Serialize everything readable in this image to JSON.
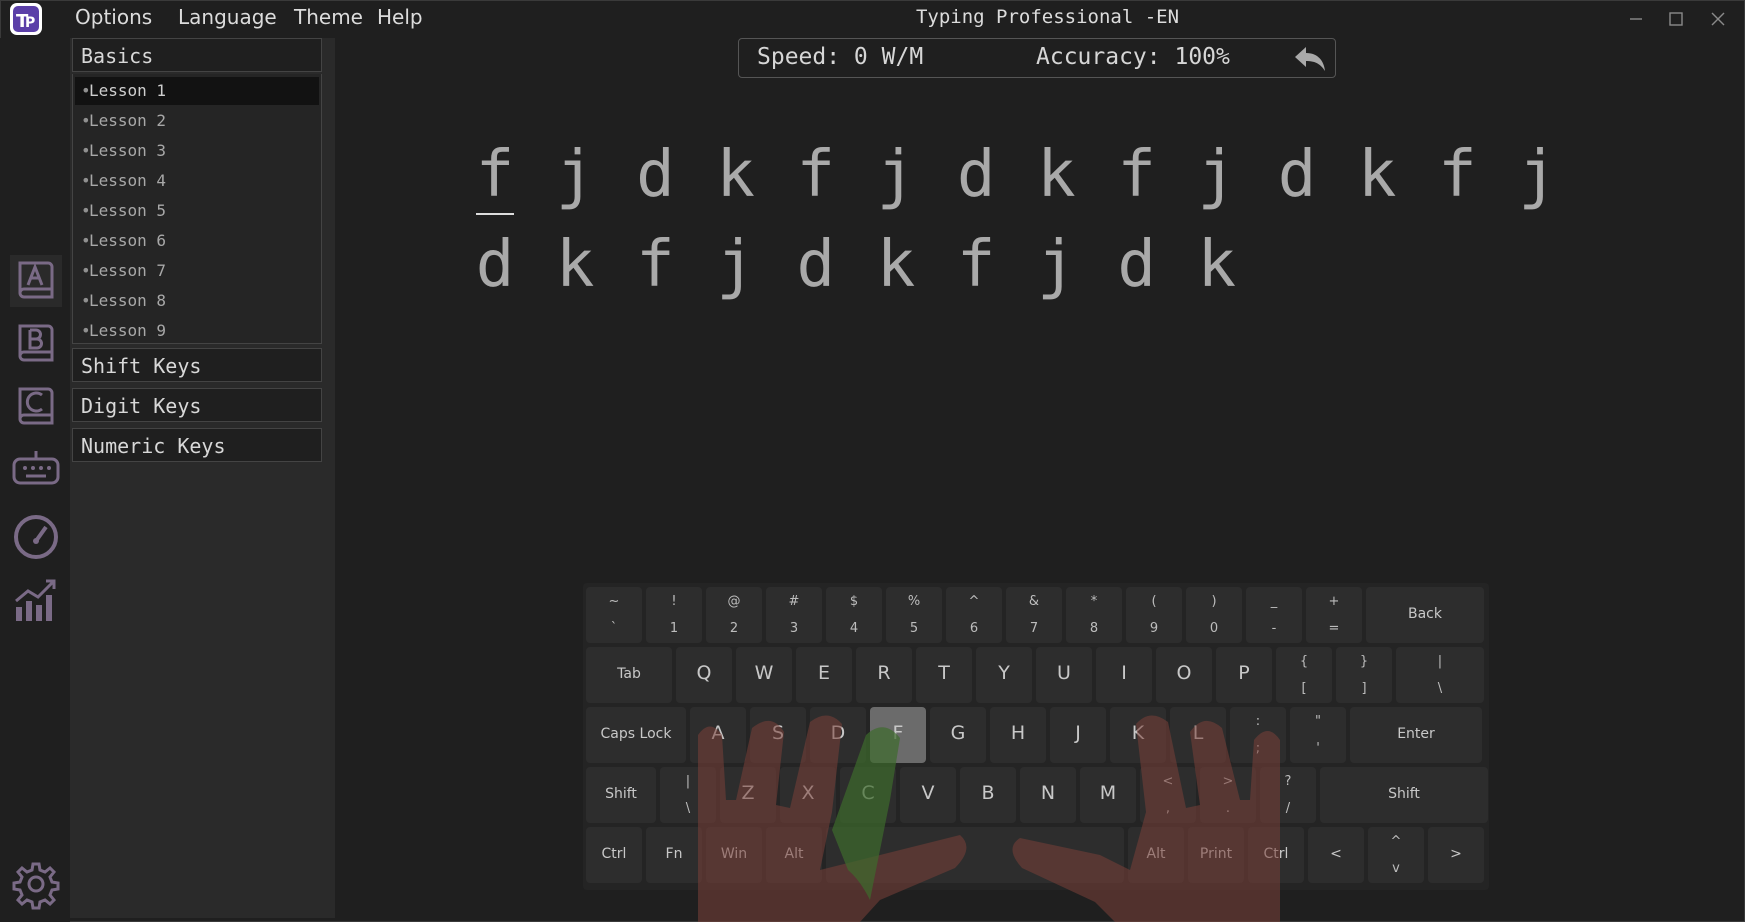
{
  "menu": {
    "options": "Options",
    "language": "Language",
    "theme": "Theme",
    "help": "Help"
  },
  "window": {
    "title": "Typing Professional -EN"
  },
  "rail": {
    "icons": [
      "lesson-a-icon",
      "lesson-b-icon",
      "lesson-c-icon",
      "keyboard-game-icon",
      "speedometer-icon",
      "statistics-icon",
      "settings-gear-icon"
    ]
  },
  "lessons": {
    "categories": {
      "basics": "Basics",
      "shift_keys": "Shift Keys",
      "digit_keys": "Digit Keys",
      "numeric_keys": "Numeric Keys"
    },
    "items": [
      "Lesson 1",
      "Lesson 2",
      "Lesson 3",
      "Lesson 4",
      "Lesson 5",
      "Lesson 6",
      "Lesson 7",
      "Lesson 8",
      "Lesson 9"
    ],
    "selected": "Lesson 1"
  },
  "stats": {
    "speed": "Speed: 0 W/M",
    "accuracy": "Accuracy: 100%"
  },
  "exercise": {
    "line1": [
      "f",
      "j",
      "d",
      "k",
      "f",
      "j",
      "d",
      "k",
      "f",
      "j",
      "d",
      "k",
      "f",
      "j"
    ],
    "line2": [
      "d",
      "k",
      "f",
      "j",
      "d",
      "k",
      "f",
      "j",
      "d",
      "k"
    ]
  },
  "keyboard": {
    "row1": [
      {
        "top": "~",
        "bot": "`"
      },
      {
        "top": "!",
        "bot": "1"
      },
      {
        "top": "@",
        "bot": "2"
      },
      {
        "top": "#",
        "bot": "3"
      },
      {
        "top": "$",
        "bot": "4"
      },
      {
        "top": "%",
        "bot": "5"
      },
      {
        "top": "^",
        "bot": "6"
      },
      {
        "top": "&",
        "bot": "7"
      },
      {
        "top": "*",
        "bot": "8"
      },
      {
        "top": "(",
        "bot": "9"
      },
      {
        "top": ")",
        "bot": "0"
      },
      {
        "top": "_",
        "bot": "-"
      },
      {
        "top": "+",
        "bot": "="
      },
      {
        "label": "Back"
      }
    ],
    "row2": [
      {
        "label": "Tab"
      },
      {
        "big": "Q"
      },
      {
        "big": "W"
      },
      {
        "big": "E"
      },
      {
        "big": "R"
      },
      {
        "big": "T"
      },
      {
        "big": "Y"
      },
      {
        "big": "U"
      },
      {
        "big": "I"
      },
      {
        "big": "O"
      },
      {
        "big": "P"
      },
      {
        "top": "{",
        "bot": "["
      },
      {
        "top": "}",
        "bot": "]"
      },
      {
        "top": "|",
        "bot": "\\"
      }
    ],
    "row3": [
      {
        "label": "Caps Lock"
      },
      {
        "big": "A"
      },
      {
        "big": "S"
      },
      {
        "big": "D"
      },
      {
        "big": "F"
      },
      {
        "big": "G"
      },
      {
        "big": "H"
      },
      {
        "big": "J"
      },
      {
        "big": "K"
      },
      {
        "big": "L"
      },
      {
        "top": ":",
        "bot": ";"
      },
      {
        "top": "\"",
        "bot": "'"
      },
      {
        "label": "Enter"
      }
    ],
    "row4": [
      {
        "label": "Shift"
      },
      {
        "top": "|",
        "bot": "\\"
      },
      {
        "big": "Z"
      },
      {
        "big": "X"
      },
      {
        "big": "C"
      },
      {
        "big": "V"
      },
      {
        "big": "B"
      },
      {
        "big": "N"
      },
      {
        "big": "M"
      },
      {
        "top": "<",
        "bot": ","
      },
      {
        "top": ">",
        "bot": "."
      },
      {
        "top": "?",
        "bot": "/"
      },
      {
        "label": "Shift"
      }
    ],
    "row5": [
      {
        "label": "Ctrl"
      },
      {
        "label": "Fn"
      },
      {
        "label": "Win"
      },
      {
        "label": "Alt"
      },
      {
        "label": ""
      },
      {
        "label": "Alt"
      },
      {
        "label": "Print"
      },
      {
        "label": "Ctrl"
      },
      {
        "label": "<"
      },
      {
        "top": "^",
        "bot": "v"
      },
      {
        "label": ">"
      }
    ],
    "highlighted_key": "F"
  },
  "colors": {
    "background": "#1f1f1f",
    "panel": "#2a2a2a",
    "accent_purple": "#7a6a86",
    "hand": "#7a3f39",
    "active_finger": "#3d6b2c"
  }
}
